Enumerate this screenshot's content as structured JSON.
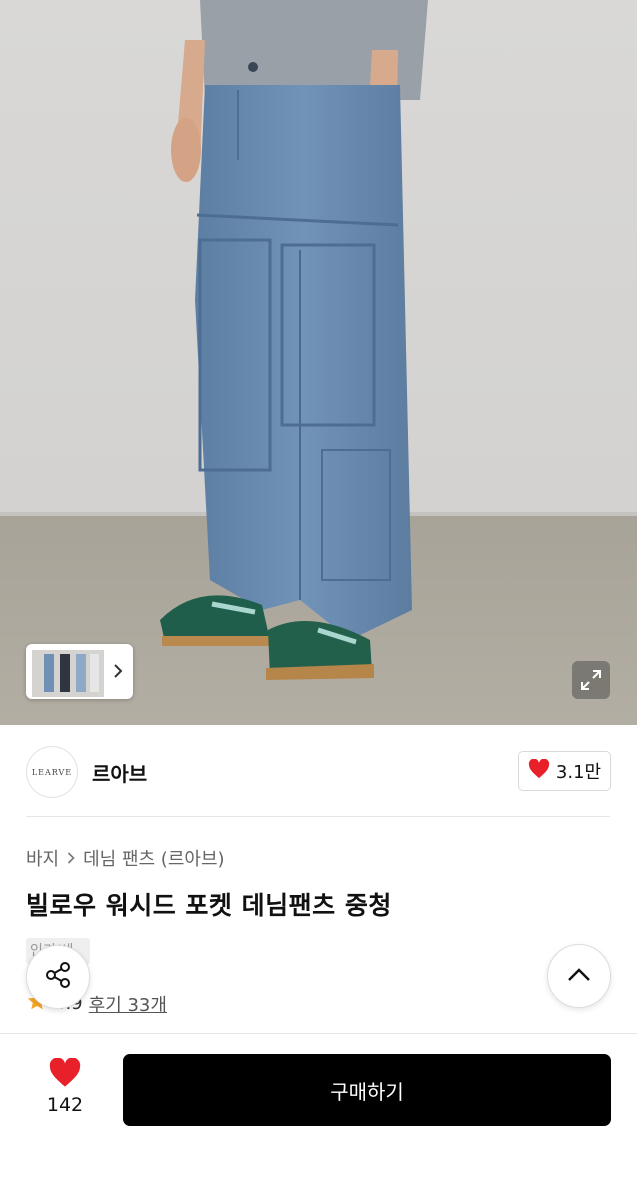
{
  "product_image": {
    "alt_icon": "expand-icon"
  },
  "seller": {
    "logo_text": "LEARVE",
    "name": "르아브",
    "likes": "3.1만"
  },
  "breadcrumb": {
    "category": "바지",
    "subcategory": "데님 팬츠 (르아브)"
  },
  "product": {
    "title": "빌로우 워시드 포켓 데님팬츠 중청",
    "tag": "인기/새",
    "rating": "4.9",
    "reviews": "후기 33개"
  },
  "bottom_bar": {
    "wish_count": "142",
    "buy_label": "구매하기"
  },
  "colors": {
    "heart": "#e8202a",
    "star": "#f5a623",
    "buy_button": "#000000"
  }
}
